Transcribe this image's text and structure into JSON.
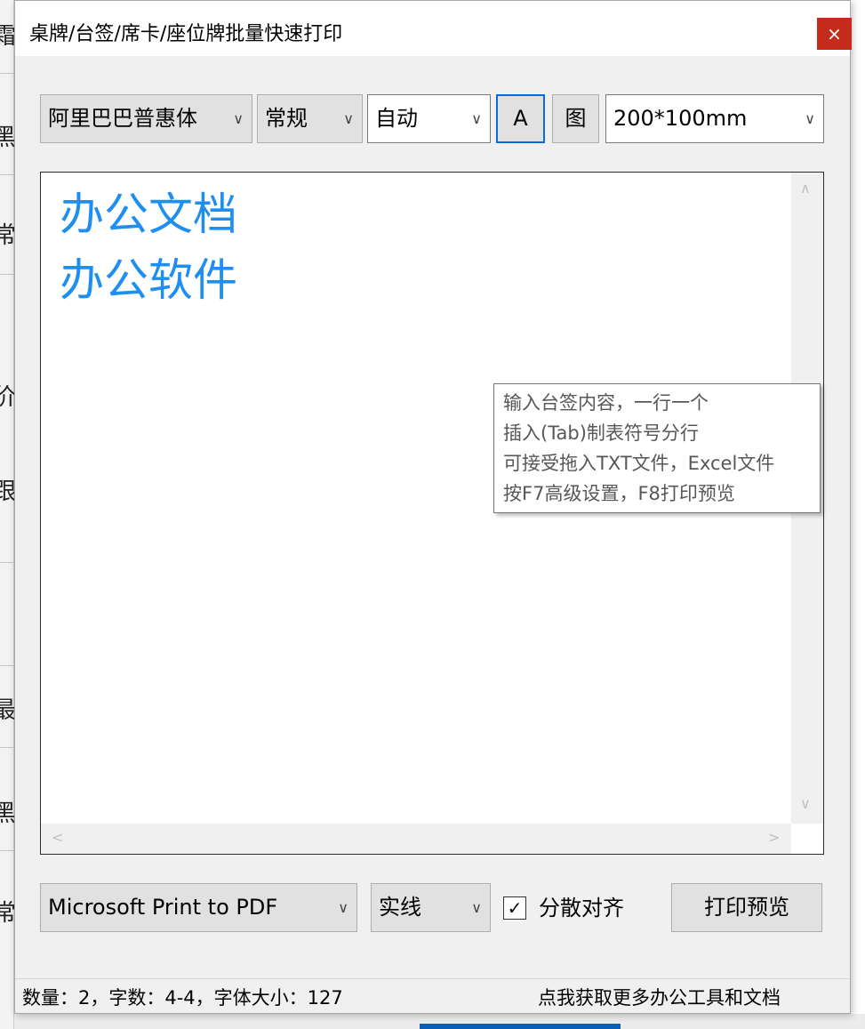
{
  "background_app": {
    "side_glyphs": [
      "霜",
      "黑",
      "常",
      "价",
      "跟",
      "最",
      "黑",
      "常"
    ]
  },
  "window": {
    "title": "桌牌/台签/席卡/座位牌批量快速打印",
    "close_label": "×"
  },
  "toolbar": {
    "font_family": "阿里巴巴普惠体",
    "font_style": "常规",
    "size_mode": "自动",
    "color_button": "A",
    "image_button": "图",
    "paper_size": "200*100mm"
  },
  "editor": {
    "lines": [
      "办公文档",
      "办公软件"
    ]
  },
  "tooltip": {
    "lines": [
      "输入台签内容，一行一个",
      "插入(Tab)制表符号分行",
      "可接受拖入TXT文件，Excel文件",
      "按F7高级设置，F8打印预览"
    ]
  },
  "bottom": {
    "printer": "Microsoft Print to PDF",
    "line_style": "实线",
    "distribute_align_label": "分散对齐",
    "distribute_align_checked": true,
    "preview_button": "打印预览"
  },
  "status": {
    "left": "数量：2，字数：4-4，字体大小：127",
    "right": "点我获取更多办公工具和文档"
  },
  "colors": {
    "editor_text": "#1e8ff0",
    "close_button": "#c42b1c",
    "focus_border": "#0a6cd8"
  },
  "icons": {
    "dropdown": "chevron-down-icon",
    "checkbox": "checkmark-icon"
  }
}
